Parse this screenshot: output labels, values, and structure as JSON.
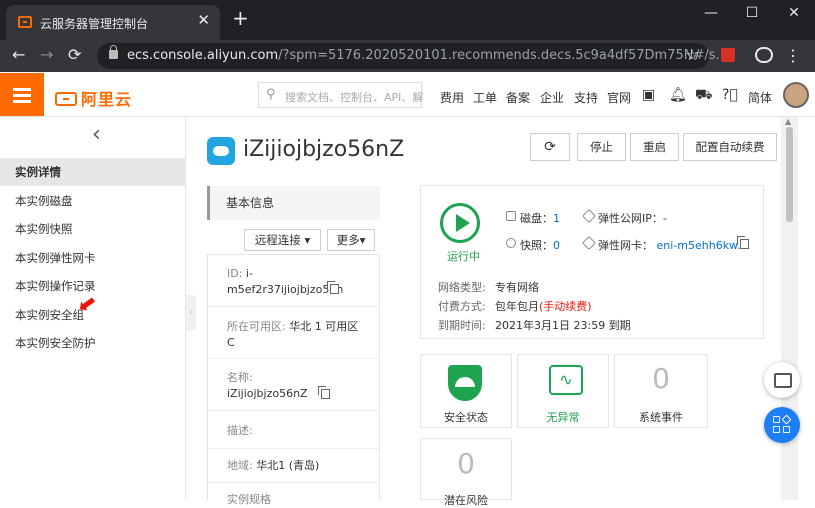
{
  "browser": {
    "tab_title": "云服务器管理控制台",
    "url_host": "ecs.console.aliyun.com",
    "url_rest": "/?spm=5176.2020520101.recommends.decs.5c9a4df57Dm75N#/s..."
  },
  "topbar": {
    "logo": "阿里云",
    "search_placeholder": "搜索文档、控制台、API、解",
    "links": [
      "费用",
      "工单",
      "备案",
      "企业",
      "支持",
      "官网"
    ],
    "lang": "简体"
  },
  "sidebar": {
    "items": [
      {
        "label": "实例详情",
        "active": true
      },
      {
        "label": "本实例磁盘"
      },
      {
        "label": "本实例快照"
      },
      {
        "label": "本实例弹性网卡"
      },
      {
        "label": "本实例操作记录"
      },
      {
        "label": "本实例安全组"
      },
      {
        "label": "本实例安全防护"
      }
    ]
  },
  "instance": {
    "name": "iZijiojbjzo56nZ",
    "toolbar": {
      "refresh": "⟳",
      "stop": "停止",
      "restart": "重启",
      "auto_renew": "配置自动续费"
    }
  },
  "basic": {
    "tab": "基本信息",
    "remote": "远程连接",
    "more": "更多",
    "id_label": "ID:",
    "id_value1": "i-",
    "id_value2": "m5ef2r37ijiojbjzo56n",
    "zone_label": "所在可用区:",
    "zone_value1": "华北 1 可用区",
    "zone_value2": "C",
    "name_label": "名称:",
    "name_value": "iZijiojbjzo56nZ",
    "desc_label": "描述:",
    "region_label": "地域:",
    "region_value": "华北1 (青岛)",
    "more_label": "实例规格"
  },
  "status": {
    "running": "运行中",
    "disk_label": "磁盘：",
    "disk_value": "1",
    "snapshot_label": "快照：",
    "snapshot_value": "0",
    "eip_label": "弹性公网IP：",
    "eip_value": "-",
    "eni_label": "弹性网卡：",
    "eni_value": "eni-m5ehh6kw...",
    "network_label": "网络类型:",
    "network_value": "专有网络",
    "pay_label": "付费方式:",
    "pay_value": "包年包月",
    "pay_note": "(手动续费)",
    "expire_label": "到期时间:",
    "expire_value": "2021年3月1日 23:59 到期"
  },
  "tiles": [
    {
      "label": "安全状态"
    },
    {
      "label": "无异常"
    },
    {
      "value": "0",
      "label": "系统事件"
    },
    {
      "value": "0",
      "label": "潜在风险"
    }
  ],
  "colors": {
    "brand": "#ff6a00",
    "ok": "#1ea34f",
    "link": "#0070cc",
    "alert": "#e8160c",
    "fab": "#1d7ff5"
  }
}
